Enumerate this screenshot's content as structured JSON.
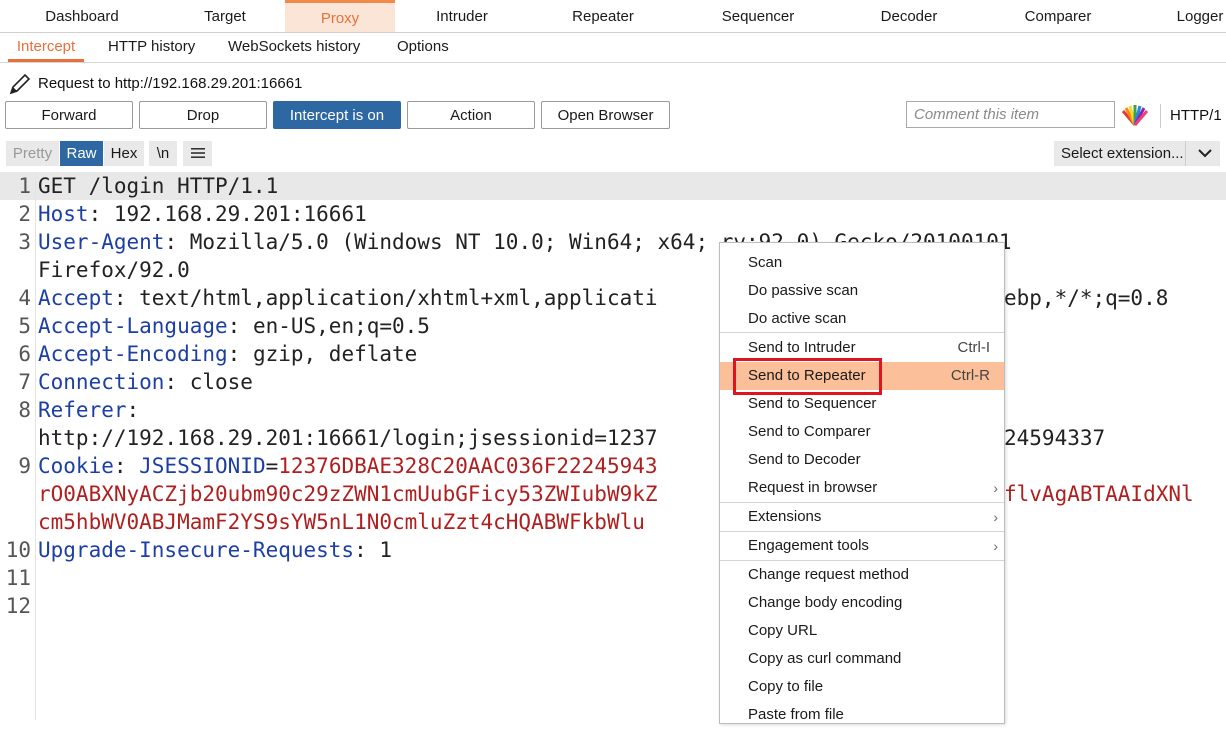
{
  "top_tabs": [
    "Dashboard",
    "Target",
    "Proxy",
    "Intruder",
    "Repeater",
    "Sequencer",
    "Decoder",
    "Comparer",
    "Logger"
  ],
  "sub_tabs": [
    "Intercept",
    "HTTP history",
    "WebSockets history",
    "Options"
  ],
  "request_label": "Request to http://192.168.29.201:16661",
  "buttons": {
    "forward": "Forward",
    "drop": "Drop",
    "intercept": "Intercept is on",
    "action": "Action",
    "open_browser": "Open Browser"
  },
  "comment_placeholder": "Comment this item",
  "http_version": "HTTP/1",
  "editor_toolbar": {
    "pretty": "Pretty",
    "raw": "Raw",
    "hex": "Hex",
    "newline": "\\n",
    "select_extension": "Select extension..."
  },
  "line_numbers": [
    "1",
    "2",
    "3",
    "4",
    "5",
    "6",
    "7",
    "8",
    "9",
    "10",
    "11",
    "12"
  ],
  "request_lines": {
    "l1": "GET /login HTTP/1.1",
    "l2k": "Host",
    "l2v": ": 192.168.29.201:16661",
    "l3k": "User-Agent",
    "l3v": ": Mozilla/5.0 (Windows NT 10.0; Win64; x64; rv:92.0) Gecko/20100101",
    "l3c": "Firefox/92.0",
    "l4k": "Accept",
    "l4v": ": text/html,application/xhtml+xml,applicati",
    "l4tail": "ebp,*/*;q=0.8",
    "l5k": "Accept-Language",
    "l5v": ": en-US,en;q=0.5",
    "l6k": "Accept-Encoding",
    "l6v": ": gzip, deflate",
    "l7k": "Connection",
    "l7v": ": close",
    "l8k": "Referer",
    "l8v": ":",
    "l8c": "http://192.168.29.201:16661/login;jsessionid=1237",
    "l8tail": "24594337",
    "l9k": "Cookie",
    "l9sep": ": ",
    "l9ck": "JSESSIONID",
    "l9eq": "=",
    "l9cv": "12376DBAE328C20AAC036F22245943",
    "l9c2": "rO0ABXNyACZjb20ubm90c29zZWN1cmUubGFicy53ZWIubW9kZ",
    "l9c2tail": "flvAgABTAAIdXNl",
    "l9c3": "cm5hbWV0ABJMamF2YS9sYW5nL1N0cmluZzt4cHQABWFkbWlu",
    "l10k": "Upgrade-Insecure-Requests",
    "l10v": ": 1"
  },
  "context_menu": {
    "scan": "Scan",
    "passive_scan": "Do passive scan",
    "active_scan": "Do active scan",
    "send_intruder": "Send to Intruder",
    "send_intruder_sc": "Ctrl-I",
    "send_repeater": "Send to Repeater",
    "send_repeater_sc": "Ctrl-R",
    "send_sequencer": "Send to Sequencer",
    "send_comparer": "Send to Comparer",
    "send_decoder": "Send to Decoder",
    "request_browser": "Request in browser",
    "extensions": "Extensions",
    "engagement_tools": "Engagement tools",
    "change_method": "Change request method",
    "change_encoding": "Change body encoding",
    "copy_url": "Copy URL",
    "copy_curl": "Copy as curl command",
    "copy_file": "Copy to file",
    "paste_file": "Paste from file"
  },
  "colors": {
    "accent": "#e8703a",
    "blue": "#2d68a3",
    "highlight": "#fbbf99",
    "redbox": "#e0141e",
    "key": "#1c3fa5",
    "cookie_value": "#b01f1f"
  }
}
